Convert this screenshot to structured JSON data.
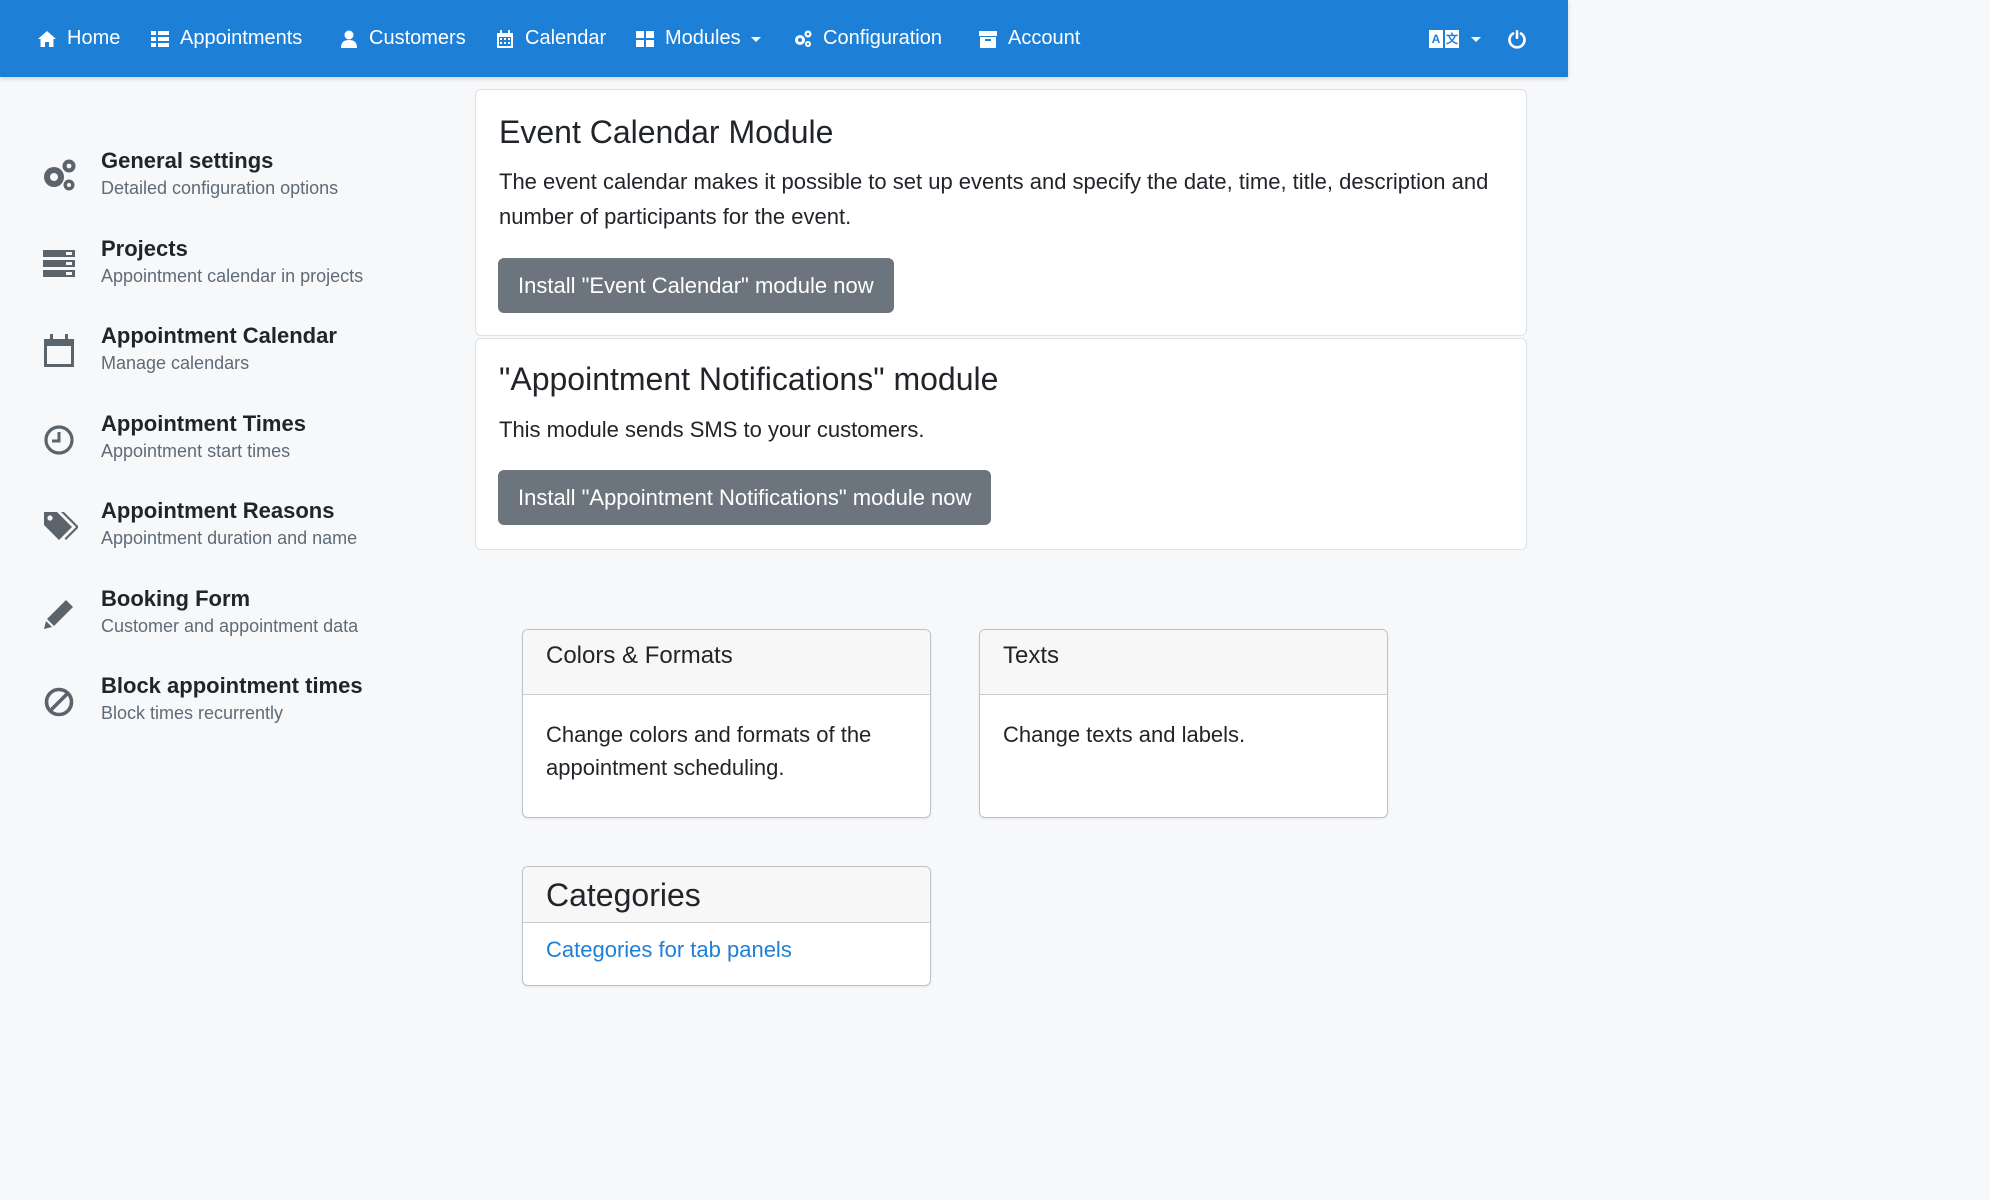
{
  "nav": {
    "home": "Home",
    "appointments": "Appointments",
    "customers": "Customers",
    "calendar": "Calendar",
    "modules": "Modules",
    "configuration": "Configuration",
    "account": "Account",
    "lang_a": "A",
    "lang_b": "文"
  },
  "sidebar": {
    "items": [
      {
        "title": "General settings",
        "sub": "Detailed configuration options",
        "icon": "cogs-icon"
      },
      {
        "title": "Projects",
        "sub": "Appointment calendar in projects",
        "icon": "server-icon"
      },
      {
        "title": "Appointment Calendar",
        "sub": "Manage calendars",
        "icon": "calendar-icon"
      },
      {
        "title": "Appointment Times",
        "sub": "Appointment start times",
        "icon": "clock-icon"
      },
      {
        "title": "Appointment Reasons",
        "sub": "Appointment duration and name",
        "icon": "tags-icon"
      },
      {
        "title": "Booking Form",
        "sub": "Customer and appointment data",
        "icon": "pencil-icon"
      },
      {
        "title": "Block appointment times",
        "sub": "Block times recurrently",
        "icon": "ban-icon"
      }
    ]
  },
  "modules": {
    "event": {
      "title": "Event Calendar Module",
      "text": "The event calendar makes it possible to set up events and specify the date, time, title, description and number of participants for the event.",
      "button": "Install \"Event Calendar\" module now"
    },
    "notifications": {
      "title": "\"Appointment Notifications\" module",
      "text": "This module sends SMS to your customers.",
      "button": "Install \"Appointment Notifications\" module now"
    }
  },
  "cards": {
    "colors": {
      "title": "Colors & Formats",
      "text": "Change colors and formats of the appointment scheduling."
    },
    "texts": {
      "title": "Texts",
      "text": "Change texts and labels."
    },
    "categories": {
      "title": "Categories",
      "link": "Categories for tab panels"
    }
  },
  "colors": {
    "navbar": "#1e7fd6",
    "button": "#6c757d",
    "background": "#f7f8fa"
  }
}
